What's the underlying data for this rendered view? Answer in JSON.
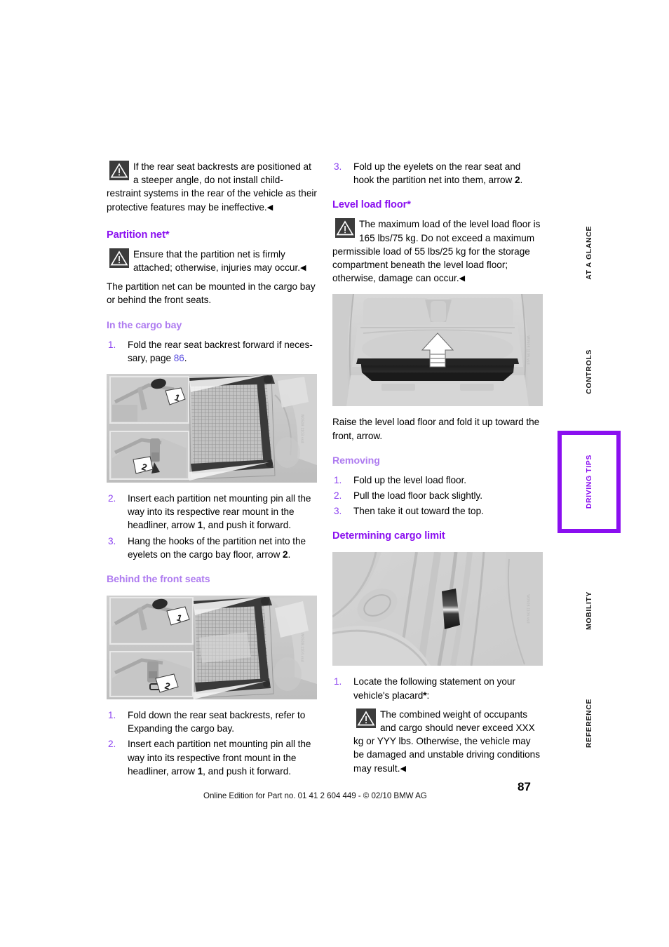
{
  "document": {
    "page_number": "87",
    "footer": "Online Edition for Part no. 01 41 2 604 449 - © 02/10  BMW AG"
  },
  "nav_tabs": [
    {
      "label": "AT A GLANCE",
      "active": false
    },
    {
      "label": "CONTROLS",
      "active": false
    },
    {
      "label": "DRIVING TIPS",
      "active": true
    },
    {
      "label": "MOBILITY",
      "active": false
    },
    {
      "label": "REFERENCE",
      "active": false
    }
  ],
  "left_column": {
    "warning_child_restraint": {
      "icon": "warning-triangle-icon",
      "text": "If the rear seat backrests are positioned at a steeper angle, do not install child-restraint systems in the rear of the vehicle as their protective features may be ineffective.",
      "end_mark": "◀"
    },
    "partition_net_heading": "Partition net*",
    "warning_partition_net": {
      "icon": "warning-triangle-icon",
      "text": "Ensure that the partition net is firmly attached; otherwise, injuries may occur.",
      "end_mark": "◀"
    },
    "intro_paragraph": "The partition net can be mounted in the cargo bay or behind the front seats.",
    "cargo_bay_heading": "In the cargo bay",
    "cargo_bay_steps": [
      {
        "num": "1.",
        "text_before": "Fold the rear seat backrest forward if neces-sary, page ",
        "page_ref": "86",
        "text_after": "."
      }
    ],
    "figure_cargo_bay": {
      "caption_credit": "W0508.1103.vsd",
      "callouts": [
        "1",
        "2"
      ]
    },
    "cargo_bay_steps_2": [
      {
        "num": "2.",
        "text_a": "Insert each partition net mounting pin all the way into its respective rear mount in the headliner, arrow ",
        "bold": "1",
        "text_b": ", and push it forward."
      },
      {
        "num": "3.",
        "text_a": "Hang the hooks of the partition net into the eyelets on the cargo bay floor, arrow ",
        "bold": "2",
        "text_b": "."
      }
    ],
    "front_seats_heading": "Behind the front seats",
    "figure_front_seats": {
      "caption_credit": "W0508.1104.vsd",
      "callouts": [
        "1",
        "2"
      ]
    },
    "front_seats_steps": [
      {
        "num": "1.",
        "text_a": "Fold down the rear seat backrests, refer to Expanding the cargo bay.",
        "bold": "",
        "text_b": ""
      },
      {
        "num": "2.",
        "text_a": "Insert each partition net mounting pin all the way into its respective front mount in the headliner, arrow ",
        "bold": "1",
        "text_b": ", and push it forward."
      }
    ]
  },
  "right_column": {
    "step_3": {
      "num": "3.",
      "text_a": "Fold up the eyelets on the rear seat and hook the partition net into them, arrow ",
      "bold": "2",
      "text_b": "."
    },
    "level_load_floor_heading": "Level load floor*",
    "warning_level_load_floor": {
      "icon": "warning-triangle-icon",
      "text": "The maximum load of the level load floor is 165 lbs/75 kg. Do not exceed a maximum permissible load of 55 lbs/25 kg for the storage compartment beneath the level load floor; otherwise, damage can occur.",
      "end_mark": "◀"
    },
    "figure_level_load_floor": {
      "caption_credit": "W0508.1105.vsd"
    },
    "raise_paragraph": "Raise the level load floor and fold it up toward the front, arrow.",
    "removing_heading": "Removing",
    "removing_steps": [
      {
        "num": "1.",
        "text": "Fold up the level load floor."
      },
      {
        "num": "2.",
        "text": "Pull the load floor back slightly."
      },
      {
        "num": "3.",
        "text": "Then take it out toward the top."
      }
    ],
    "cargo_limit_heading": "Determining cargo limit",
    "figure_placard": {
      "caption_credit": "W0508.1106.vsd"
    },
    "cargo_limit_steps": [
      {
        "num": "1.",
        "text_a": "Locate the following statement on your vehicle's placard",
        "bold": "*",
        "text_b": ":"
      }
    ],
    "warning_combined_weight": {
      "icon": "warning-triangle-icon",
      "text": "The combined weight of occupants and cargo should never exceed XXX kg or YYY lbs. Otherwise, the vehicle may be damaged and unstable driving conditions may result.",
      "end_mark": "◀"
    }
  },
  "colors": {
    "heading_purple": "#8a0ff0",
    "subheading_lavender": "#ae7bf0",
    "list_number_purple": "#8a3ff0",
    "page_ref_blue": "#5b4fe0"
  }
}
